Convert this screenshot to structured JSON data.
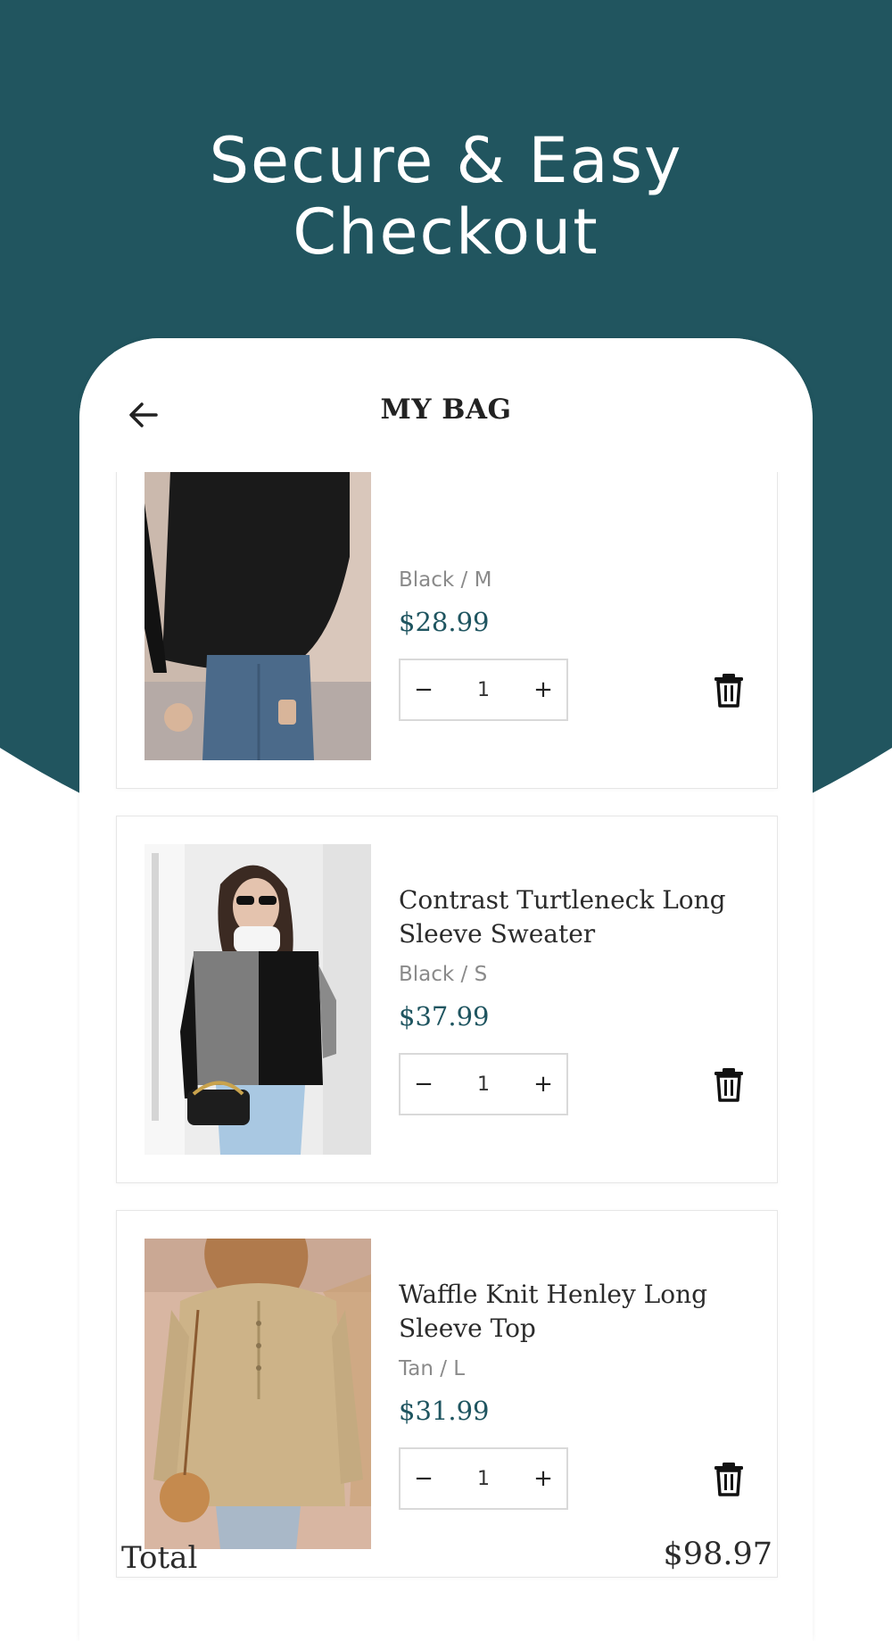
{
  "colors": {
    "teal": "#21555f",
    "price": "#1f5560",
    "card_border": "#e6e6e6"
  },
  "promo": {
    "title_line1": "Secure & Easy",
    "title_line2": "Checkout"
  },
  "header": {
    "title": "MY BAG",
    "back_icon": "arrow-left-icon"
  },
  "bag": {
    "items": [
      {
        "name": "",
        "variant": "Black / M",
        "price": "$28.99",
        "quantity": "1",
        "minus": "−",
        "plus": "+",
        "delete_icon": "trash-icon"
      },
      {
        "name": "Contrast Turtleneck Long Sleeve Sweater",
        "variant": "Black / S",
        "price": "$37.99",
        "quantity": "1",
        "minus": "−",
        "plus": "+",
        "delete_icon": "trash-icon"
      },
      {
        "name": "Waffle Knit Henley Long Sleeve Top",
        "variant": "Tan / L",
        "price": "$31.99",
        "quantity": "1",
        "minus": "−",
        "plus": "+",
        "delete_icon": "trash-icon"
      }
    ]
  },
  "summary": {
    "total_label": "Total",
    "total_value": "$98.97"
  }
}
